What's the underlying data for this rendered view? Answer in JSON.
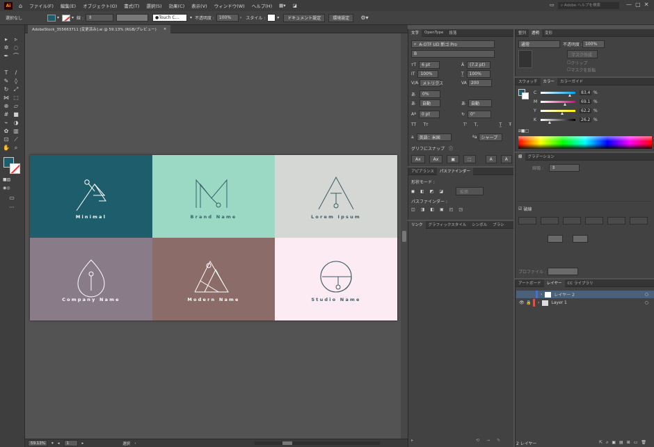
{
  "menubar": {
    "app_icon": "Ai",
    "items": [
      "ファイル(F)",
      "編集(E)",
      "オブジェクト(O)",
      "書式(T)",
      "選択(S)",
      "効果(C)",
      "表示(V)",
      "ウィンドウ(W)",
      "ヘルプ(H)"
    ],
    "help_search_placeholder": "Adobe ヘルプを検索"
  },
  "controlbar": {
    "selection_label": "選択なし",
    "stroke_label": "線 :",
    "brush_label": "Touch C...",
    "opacity_label": "不透明度 :",
    "opacity_value": "100%",
    "style_label": "スタイル :",
    "document_setup": "ドキュメント設定",
    "preferences": "環境設定"
  },
  "document_tab": {
    "title": "AdobeStock_355663711 [変更済み].ai @ 59.13% (RGB/プレビュー)",
    "close": "×"
  },
  "status": {
    "zoom": "59.13%",
    "artboard": "1",
    "mode": "選択"
  },
  "artboard": {
    "tiles": [
      {
        "label": "Minimal",
        "bg": "#1d5d6c",
        "fg": "#ffffff",
        "icon": "triangle-circle-logo"
      },
      {
        "label": "Brand Name",
        "bg": "#9cd9c4",
        "fg": "#35606a",
        "icon": "letter-m-logo"
      },
      {
        "label": "Lorem Ipsum",
        "bg": "#d4d7d3",
        "fg": "#3a5a63",
        "icon": "triangle-t-logo"
      },
      {
        "label": "Company Name",
        "bg": "#8a7b88",
        "fg": "#ffffff",
        "icon": "drop-logo"
      },
      {
        "label": "Modern Name",
        "bg": "#8b6c69",
        "fg": "#ffffff",
        "icon": "double-triangle-logo"
      },
      {
        "label": "Studio Name",
        "bg": "#fcebf2",
        "fg": "#3a5a63",
        "icon": "circle-g-logo"
      }
    ]
  },
  "character_panel": {
    "tabs": [
      "文字",
      "OpenType",
      "段落"
    ],
    "font_family": "A-OTF UD 新ゴ Pro",
    "font_style": "B",
    "font_size": "6 pt",
    "leading": "(7.2 pt)",
    "vertical_scale": "100%",
    "horizontal_scale": "100%",
    "kerning": "メトリクス",
    "tracking": "200",
    "tsume": "0%",
    "aki_left": "自動",
    "aki_right": "自動",
    "baseline_shift": "0 pt",
    "rotation": "0°",
    "language": "英語：米国",
    "antialias": "シャープ",
    "snap_label": "グリフにスナップ"
  },
  "pathfinder_panel": {
    "tabs": [
      "アピアランス",
      "パスファインダー"
    ],
    "shape_modes": "形状モード :",
    "expand": "拡張",
    "pathfinders": "パスファインダー :"
  },
  "links_panel": {
    "tabs": [
      "リンク",
      "グラフィックスタイル",
      "シンボル",
      "ブラシ"
    ]
  },
  "transparency_panel": {
    "tabs": [
      "整列",
      "透明",
      "変形"
    ],
    "blend_mode": "通常",
    "opacity_label": "不透明度 :",
    "opacity_value": "100%",
    "make_mask": "マスク作成",
    "clip": "クリップ",
    "invert_mask": "マスクを反転"
  },
  "color_panel": {
    "tabs": [
      "スウォッチ",
      "カラー",
      "カラーガイド"
    ],
    "channels": [
      {
        "name": "C",
        "value": "83.4",
        "unit": "%"
      },
      {
        "name": "M",
        "value": "69.1",
        "unit": "%"
      },
      {
        "name": "Y",
        "value": "62.2",
        "unit": "%"
      },
      {
        "name": "K",
        "value": "26.2",
        "unit": "%"
      }
    ]
  },
  "stroke_panel": {
    "tabs": [
      "線",
      "グラデーション"
    ],
    "weight_label": "線幅 :",
    "dashed": "破線",
    "profile_label": "プロファイル :"
  },
  "layers_panel": {
    "tabs": [
      "アートボード",
      "レイヤー",
      "CC ライブラリ"
    ],
    "layers": [
      {
        "name": "レイヤー 2",
        "color": "#4f6fbf",
        "selected": true
      },
      {
        "name": "Layer 1",
        "color": "#d9534f",
        "selected": false
      }
    ],
    "count": "2 レイヤー"
  }
}
